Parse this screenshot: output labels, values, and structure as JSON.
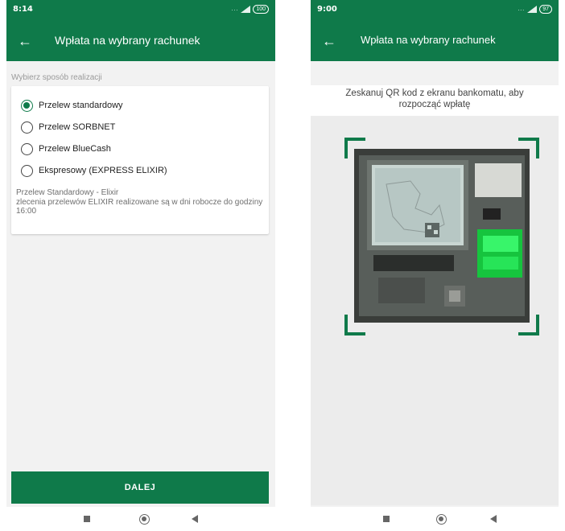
{
  "left_screen": {
    "status": {
      "time": "8:14",
      "signal": "...",
      "battery": "100"
    },
    "app_bar": {
      "title": "Wpłata na wybrany rachunek"
    },
    "section_label": "Wybierz sposób realizacji",
    "options": [
      {
        "label": "Przelew standardowy",
        "selected": true
      },
      {
        "label": "Przelew SORBNET",
        "selected": false
      },
      {
        "label": "Przelew BlueCash",
        "selected": false
      },
      {
        "label": "Ekspresowy (EXPRESS ELIXIR)",
        "selected": false
      }
    ],
    "description": {
      "line1": "Przelew Standardowy - Elixir",
      "line2": "zlecenia przelewów ELIXIR realizowane są w dni robocze do godziny 16:00"
    },
    "button": {
      "label": "DALEJ"
    }
  },
  "right_screen": {
    "status": {
      "time": "9:00",
      "signal": "...",
      "battery": "97"
    },
    "app_bar": {
      "title": "Wpłata na wybrany rachunek"
    },
    "instruction": "Zeskanuj QR kod z ekranu bankomatu, aby rozpocząć wpłatę"
  },
  "icons": {
    "back": "arrow-left-icon",
    "home": "circle-home-icon",
    "recents": "square-recents-icon",
    "nav_back": "triangle-back-icon"
  },
  "colors": {
    "brand": "#0f7a4a",
    "background": "#f2f2f2"
  }
}
